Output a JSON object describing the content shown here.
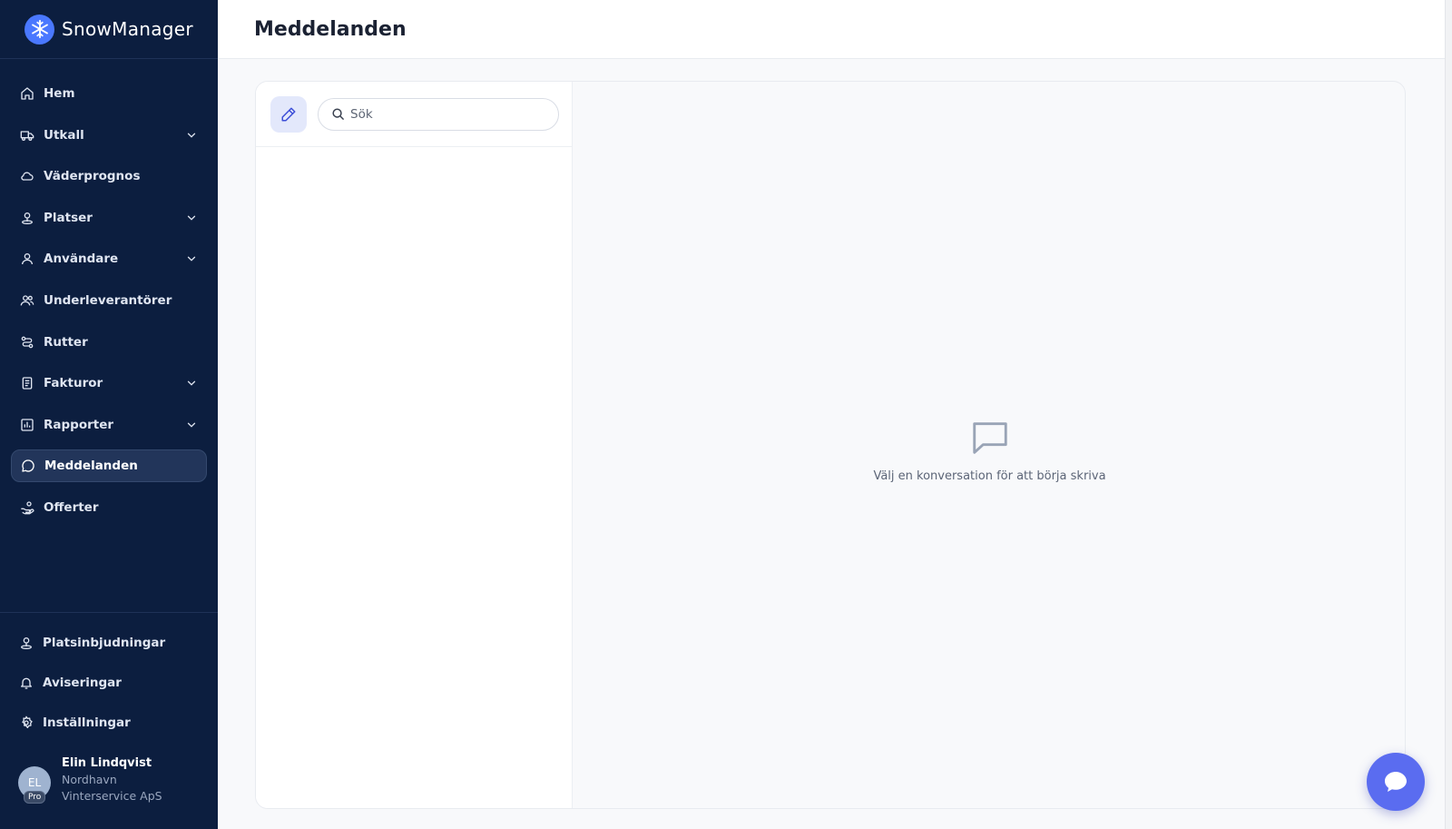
{
  "app": {
    "name": "SnowManager"
  },
  "sidebar": {
    "items": [
      {
        "label": "Hem",
        "icon": "home-icon",
        "has_chevron": false
      },
      {
        "label": "Utkall",
        "icon": "truck-icon",
        "has_chevron": true
      },
      {
        "label": "Väderprognos",
        "icon": "cloud-icon",
        "has_chevron": false
      },
      {
        "label": "Platser",
        "icon": "location-pin-icon",
        "has_chevron": true
      },
      {
        "label": "Användare",
        "icon": "user-icon",
        "has_chevron": true
      },
      {
        "label": "Underleverantörer",
        "icon": "users-icon",
        "has_chevron": false
      },
      {
        "label": "Rutter",
        "icon": "route-icon",
        "has_chevron": false
      },
      {
        "label": "Fakturor",
        "icon": "invoice-icon",
        "has_chevron": true
      },
      {
        "label": "Rapporter",
        "icon": "bar-chart-icon",
        "has_chevron": true
      },
      {
        "label": "Meddelanden",
        "icon": "chat-bubble-icon",
        "has_chevron": false,
        "active": true
      },
      {
        "label": "Offerter",
        "icon": "hand-offer-icon",
        "has_chevron": false
      }
    ],
    "bottom_items": [
      {
        "label": "Platsinbjudningar",
        "icon": "location-pin-icon"
      },
      {
        "label": "Aviseringar",
        "icon": "bell-icon"
      },
      {
        "label": "Inställningar",
        "icon": "gear-icon"
      }
    ],
    "user": {
      "initials": "EL",
      "badge": "Pro",
      "name": "Elin Lindqvist",
      "company": "Nordhavn Vinterservice ApS"
    }
  },
  "header": {
    "title": "Meddelanden"
  },
  "messages": {
    "search_placeholder": "Sök",
    "search_value": "",
    "empty_state_text": "Välj en konversation för att börja skriva"
  },
  "colors": {
    "sidebar_bg": "#0c1e3f",
    "accent": "#5a6cf0",
    "brand_logo": "#4a78ff"
  }
}
